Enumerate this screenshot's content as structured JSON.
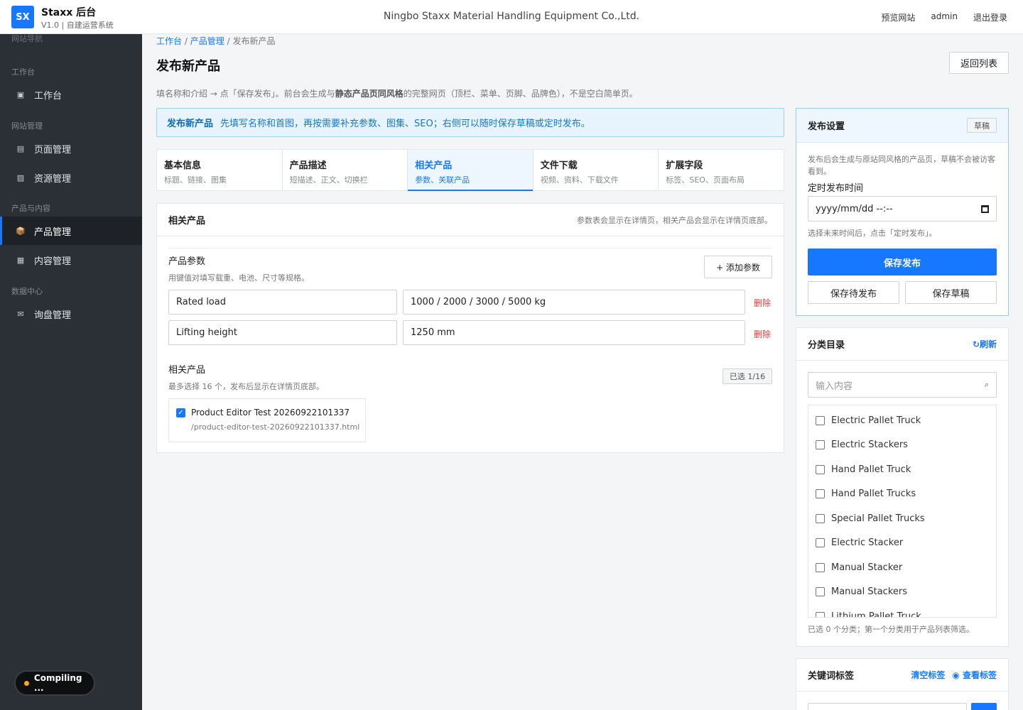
{
  "header": {
    "logo_text": "SX",
    "brand_title": "Staxx 后台",
    "brand_subtitle": "V1.0 | 自建运营系统",
    "site_name": "Ningbo Staxx Material Handling Equipment Co.,Ltd.",
    "links": [
      "预览网站",
      "admin",
      "退出登录"
    ]
  },
  "sidebar": {
    "ghost_label": "网站导航",
    "groups": [
      "工作台",
      "网站管理",
      "产品与内容",
      "数据中心"
    ],
    "items": [
      {
        "label": "工作台",
        "icon": "▣"
      },
      {
        "label": "页面管理",
        "icon": "▤"
      },
      {
        "label": "资源管理",
        "icon": "▨"
      },
      {
        "label": "产品管理",
        "icon": "📦"
      },
      {
        "label": "内容管理",
        "icon": "▦"
      },
      {
        "label": "询盘管理",
        "icon": "✉"
      }
    ],
    "compiling_label": "Compiling ..."
  },
  "breadcrumb": {
    "items": [
      "工作台",
      "产品管理",
      "发布新产品"
    ],
    "sep": "/"
  },
  "page": {
    "title": "发布新产品",
    "back_label": "返回列表",
    "desc_pre": "填名称和介绍 → 点「保存发布」。前台会生成与",
    "desc_bold": "静态产品页同风格",
    "desc_post": "的完整网页（顶栏、菜单、页脚、品牌色），不是空白简单页。"
  },
  "notice": {
    "title": "发布新产品",
    "text": "先填写名称和首图，再按需要补充参数、图集、SEO；右侧可以随时保存草稿或定时发布。"
  },
  "tabs": [
    {
      "title": "基本信息",
      "sub": "标题、链接、图集"
    },
    {
      "title": "产品描述",
      "sub": "短描述、正文、切换栏"
    },
    {
      "title": "相关产品",
      "sub": "参数、关联产品"
    },
    {
      "title": "文件下载",
      "sub": "视频、资料、下载文件"
    },
    {
      "title": "扩展字段",
      "sub": "标签、SEO、页面布局"
    }
  ],
  "card": {
    "title": "相关产品",
    "note": "参数表会显示在详情页，相关产品会显示在详情页底部。",
    "params_title": "产品参数",
    "params_note": "用键值对填写载重、电池、尺寸等规格。",
    "add_param_label": "+ 添加参数",
    "params": [
      {
        "key": "Rated load",
        "value": "1000 / 2000 / 3000 / 5000 kg"
      },
      {
        "key": "Lifting height",
        "value": "1250 mm"
      }
    ],
    "delete_label": "删除",
    "related_title": "相关产品",
    "related_note": "最多选择 16 个，发布后显示在详情页底部。",
    "selected_badge": "已选 1/16",
    "related_items": [
      {
        "name": "Product Editor Test 20260922101337",
        "url": "/product-editor-test-20260922101337.html",
        "checked": true
      }
    ]
  },
  "publish": {
    "title": "发布设置",
    "status": "草稿",
    "text": "发布后会生成与原站同风格的产品页，草稿不会被访客看到。",
    "schedule_label": "定时发布时间",
    "date_placeholder": "yyyy/mm/dd  --:--",
    "hint": "选择未来时间后，点击「定时发布」。",
    "primary_label": "保存发布",
    "pending_label": "保存待发布",
    "draft_label": "保存草稿"
  },
  "categories": {
    "title": "分类目录",
    "refresh_label": "↻刷新",
    "search_placeholder": "输入内容",
    "items": [
      "Electric Pallet Truck",
      "Electric Stackers",
      "Hand Pallet Truck",
      "Hand Pallet Trucks",
      "Special Pallet Trucks",
      "Electric Stacker",
      "Manual Stacker",
      "Manual Stackers",
      "Lithium Pallet Truck"
    ],
    "footer": "已选 0 个分类；第一个分类用于产品列表筛选。"
  },
  "keywords": {
    "title": "关键词标签",
    "clear_label": "清空标签",
    "view_label": "◉ 查看标签"
  },
  "colors": {
    "accent": "#1677ff",
    "sidebar_bg": "#2b2f36",
    "danger": "#e53935"
  }
}
